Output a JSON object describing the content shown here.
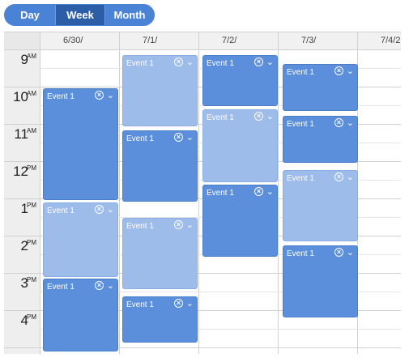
{
  "views": {
    "day": "Day",
    "week": "Week",
    "month": "Month",
    "active": "Week"
  },
  "columns": [
    "6/30/",
    "7/1/",
    "7/2/",
    "7/3/",
    "7/4/2"
  ],
  "hours": [
    {
      "num": "9",
      "ampm": "AM"
    },
    {
      "num": "10",
      "ampm": "AM"
    },
    {
      "num": "11",
      "ampm": "AM"
    },
    {
      "num": "12",
      "ampm": "PM"
    },
    {
      "num": "1",
      "ampm": "PM"
    },
    {
      "num": "2",
      "ampm": "PM"
    },
    {
      "num": "3",
      "ampm": "PM"
    },
    {
      "num": "4",
      "ampm": "PM"
    }
  ],
  "events": [
    {
      "title": "Event 1",
      "column": "6/30/",
      "style": "dark"
    },
    {
      "title": "Event 1",
      "column": "6/30/",
      "style": "light"
    },
    {
      "title": "Event 1",
      "column": "6/30/",
      "style": "dark"
    },
    {
      "title": "Event 1",
      "column": "7/1/",
      "style": "light"
    },
    {
      "title": "Event 1",
      "column": "7/1/",
      "style": "dark"
    },
    {
      "title": "Event 1",
      "column": "7/1/",
      "style": "light"
    },
    {
      "title": "Event 1",
      "column": "7/1/",
      "style": "dark"
    },
    {
      "title": "Event 1",
      "column": "7/2/",
      "style": "dark"
    },
    {
      "title": "Event 1",
      "column": "7/2/",
      "style": "light"
    },
    {
      "title": "Event 1",
      "column": "7/2/",
      "style": "dark"
    },
    {
      "title": "Event 1",
      "column": "7/3/",
      "style": "dark"
    },
    {
      "title": "Event 1",
      "column": "7/3/",
      "style": "dark"
    },
    {
      "title": "Event 1",
      "column": "7/3/",
      "style": "light"
    },
    {
      "title": "Event 1",
      "column": "7/3/",
      "style": "dark"
    }
  ],
  "icons": {
    "close": "close-circle-icon",
    "expand": "chevron-down-icon"
  },
  "colors": {
    "accent": "#4a82d6",
    "active_view": "#2c5ea8",
    "event_dark": "#5b8fdc",
    "event_light": "#9ebcea"
  }
}
